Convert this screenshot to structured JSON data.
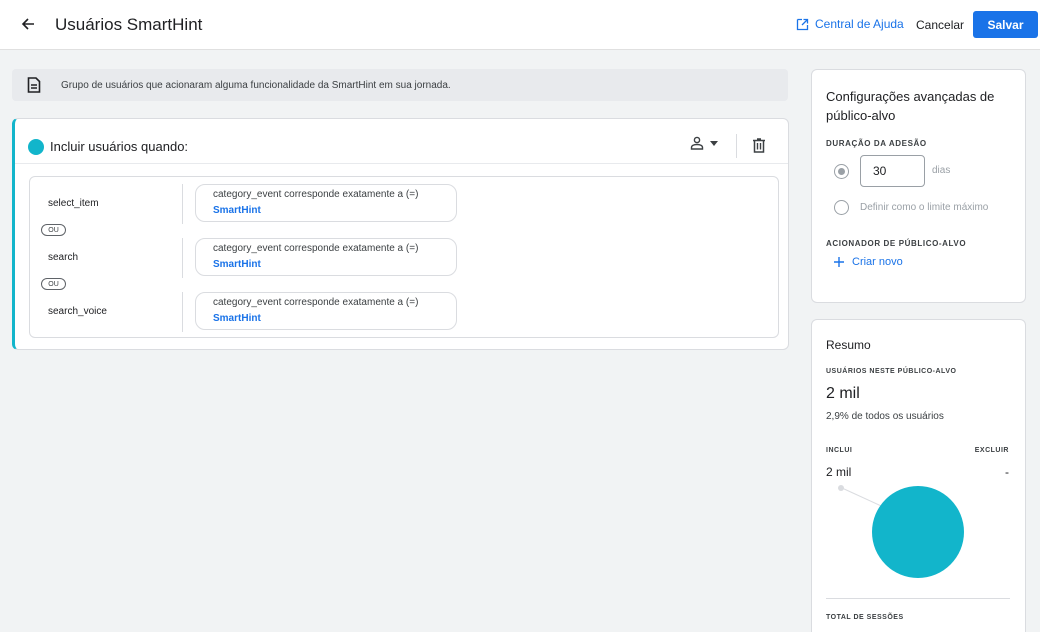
{
  "header": {
    "title": "Usuários SmartHint",
    "help_label": "Central de Ajuda",
    "cancel_label": "Cancelar",
    "save_label": "Salvar"
  },
  "info": {
    "text": "Grupo de usuários que acionaram alguma funcionalidade da SmartHint em sua jornada."
  },
  "condition": {
    "title": "Incluir usuários quando:",
    "or_label": "OU",
    "rows": [
      {
        "event": "select_item",
        "condition": "category_event corresponde exatamente a (=)",
        "value": "SmartHint"
      },
      {
        "event": "search",
        "condition": "category_event corresponde exatamente a (=)",
        "value": "SmartHint"
      },
      {
        "event": "search_voice",
        "condition": "category_event corresponde exatamente a (=)",
        "value": "SmartHint"
      }
    ]
  },
  "config": {
    "title": "Configurações avançadas de público-alvo",
    "duration_label": "DURAÇÃO DA ADESÃO",
    "duration_value": "30",
    "duration_unit": "dias",
    "max_limit_label": "Definir como o limite máximo",
    "trigger_label": "ACIONADOR DE PÚBLICO-ALVO",
    "create_new_label": "Criar novo"
  },
  "summary": {
    "title": "Resumo",
    "users_label": "USUÁRIOS NESTE PÚBLICO-ALVO",
    "users_value": "2 mil",
    "users_pct": "2,9% de todos os usuários",
    "includes_label": "INCLUI",
    "excludes_label": "EXCLUIR",
    "includes_value": "2 mil",
    "excludes_value": "-",
    "sessions_label": "TOTAL DE SESSÕES"
  },
  "colors": {
    "accent": "#1a73e8",
    "teal": "#12b5cb"
  }
}
